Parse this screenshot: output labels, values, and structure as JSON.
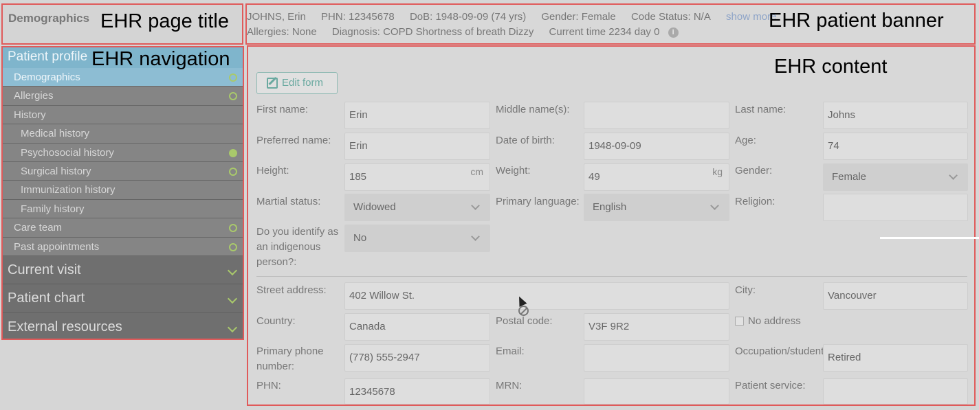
{
  "page_title": "Demographics",
  "annotations": {
    "page_title": "EHR page title",
    "banner": "EHR patient banner",
    "navigation": "EHR navigation",
    "content": "EHR content"
  },
  "banner": {
    "name": "JOHNS, Erin",
    "phn": "PHN: 12345678",
    "dob": "DoB: 1948-09-09 (74 yrs)",
    "gender": "Gender: Female",
    "code_status": "Code Status: N/A",
    "show_more": "show more",
    "allergies": "Allergies: None",
    "diagnosis": "Diagnosis: COPD Shortness of breath Dizzy",
    "current_time": "Current time 2234 day 0",
    "info_icon": "i"
  },
  "nav": {
    "header": "Patient profile",
    "items": [
      {
        "label": "Demographics",
        "level": 1,
        "active": true,
        "dot": "open"
      },
      {
        "label": "Allergies",
        "level": 1,
        "dot": "open"
      },
      {
        "label": "History",
        "level": 1
      },
      {
        "label": "Medical history",
        "level": 2
      },
      {
        "label": "Psychosocial history",
        "level": 2,
        "dot": "filled"
      },
      {
        "label": "Surgical history",
        "level": 2,
        "dot": "open"
      },
      {
        "label": "Immunization history",
        "level": 2
      },
      {
        "label": "Family history",
        "level": 2
      },
      {
        "label": "Care team",
        "level": 1,
        "dot": "open"
      },
      {
        "label": "Past appointments",
        "level": 1,
        "dot": "open"
      }
    ],
    "sections": [
      "Current visit",
      "Patient chart",
      "External resources"
    ]
  },
  "content": {
    "edit_button": "Edit form",
    "fields": {
      "first_name": {
        "label": "First name:",
        "value": "Erin"
      },
      "middle_name": {
        "label": "Middle name(s):",
        "value": ""
      },
      "last_name": {
        "label": "Last name:",
        "value": "Johns"
      },
      "preferred_name": {
        "label": "Preferred name:",
        "value": "Erin"
      },
      "dob": {
        "label": "Date of birth:",
        "value": "1948-09-09"
      },
      "age": {
        "label": "Age:",
        "value": "74"
      },
      "height": {
        "label": "Height:",
        "value": "185",
        "unit": "cm"
      },
      "weight": {
        "label": "Weight:",
        "value": "49",
        "unit": "kg"
      },
      "gender": {
        "label": "Gender:",
        "value": "Female"
      },
      "marital": {
        "label": "Martial status:",
        "value": "Widowed"
      },
      "language": {
        "label": "Primary language:",
        "value": "English"
      },
      "religion": {
        "label": "Religion:",
        "value": ""
      },
      "indigenous": {
        "label_l1": "Do you identify as",
        "label_l2": "an indigenous",
        "label_l3": "person?:",
        "value": "No"
      },
      "street": {
        "label": "Street address:",
        "value": "402 Willow St."
      },
      "city": {
        "label": "City:",
        "value": "Vancouver"
      },
      "country": {
        "label": "Country:",
        "value": "Canada"
      },
      "postal": {
        "label": "Postal code:",
        "value": "V3F 9R2"
      },
      "no_address": {
        "label": "No address"
      },
      "phone": {
        "label_l1": "Primary phone",
        "label_l2": "number:",
        "value": "(778) 555-2947"
      },
      "email": {
        "label": "Email:",
        "value": ""
      },
      "occupation": {
        "label": "Occupation/student:",
        "value": "Retired"
      },
      "phn": {
        "label": "PHN:",
        "value": "12345678"
      },
      "mrn": {
        "label": "MRN:",
        "value": ""
      },
      "patient_service": {
        "label": "Patient service:",
        "value": ""
      }
    }
  }
}
